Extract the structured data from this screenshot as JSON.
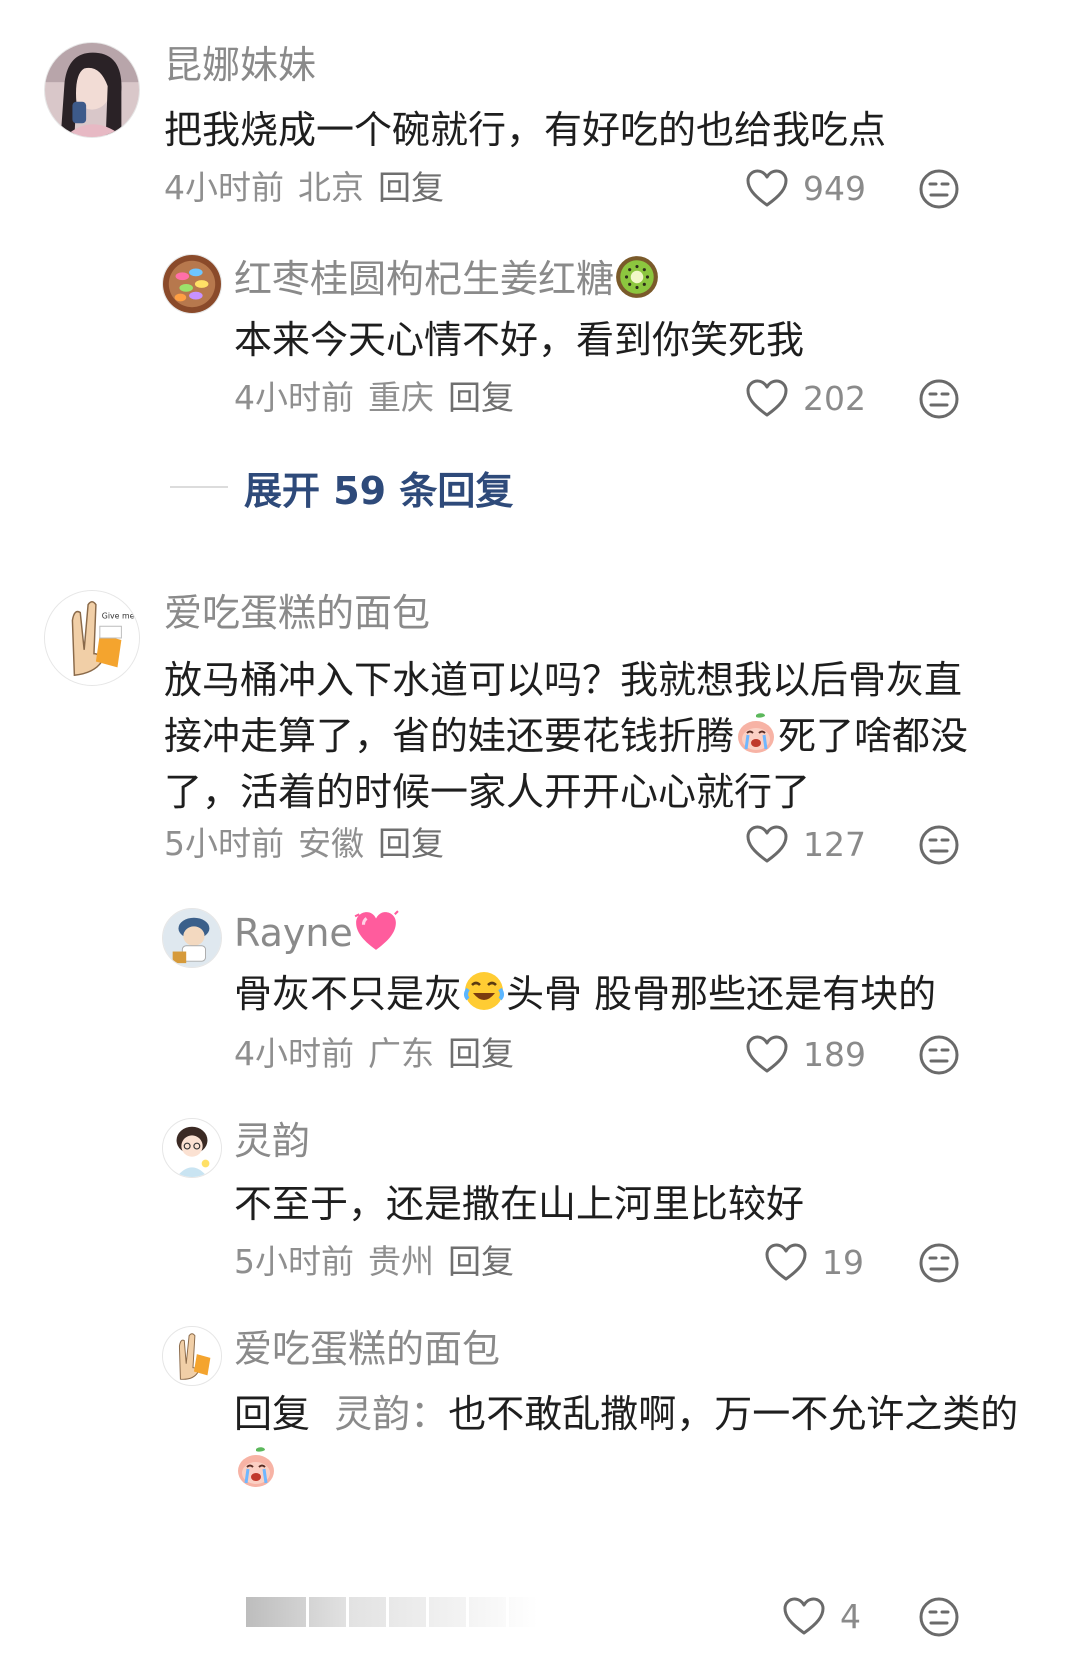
{
  "comments": [
    {
      "username": "昆娜妹妹",
      "text": "把我烧成一个碗就行，有好吃的也给我吃点",
      "time": "4小时前",
      "location": "北京",
      "reply_label": "回复",
      "likes": "949",
      "replies": [
        {
          "username": "红枣桂圆枸杞生姜红糖",
          "username_emoji": "kiwi-icon",
          "text": "本来今天心情不好，看到你笑死我",
          "time": "4小时前",
          "location": "重庆",
          "reply_label": "回复",
          "likes": "202"
        }
      ],
      "expand_label": "展开 59 条回复"
    },
    {
      "username": "爱吃蛋糕的面包",
      "text_part1": "放马桶冲入下水道可以吗？我就想我以后骨灰直接冲走算了，省的娃还要花钱折腾",
      "text_part2": "死了啥都没了，活着的时候一家人开开心心就行了",
      "text_emoji": "crying-peach-icon",
      "time": "5小时前",
      "location": "安徽",
      "reply_label": "回复",
      "likes": "127",
      "replies": [
        {
          "username": "Rayne",
          "username_emoji": "sparkling-heart-icon",
          "text_part1": "骨灰不只是灰",
          "text_part2": "头骨 股骨那些还是有块的",
          "text_emoji": "laughing-tears-icon",
          "time": "4小时前",
          "location": "广东",
          "reply_label": "回复",
          "likes": "189"
        },
        {
          "username": "灵韵",
          "text": "不至于，还是撒在山上河里比较好",
          "time": "5小时前",
          "location": "贵州",
          "reply_label": "回复",
          "likes": "19"
        },
        {
          "username": "爱吃蛋糕的面包",
          "reply_prefix": "回复",
          "reply_to": "灵韵：",
          "text": "也不敢乱撒啊，万一不允许之类的",
          "text_emoji": "crying-peach-icon",
          "likes": "4"
        }
      ]
    }
  ],
  "colors": {
    "username": "#8a8a8a",
    "text": "#1e1e1e",
    "meta": "#8f8f8f",
    "expand": "#2e4a7a"
  }
}
